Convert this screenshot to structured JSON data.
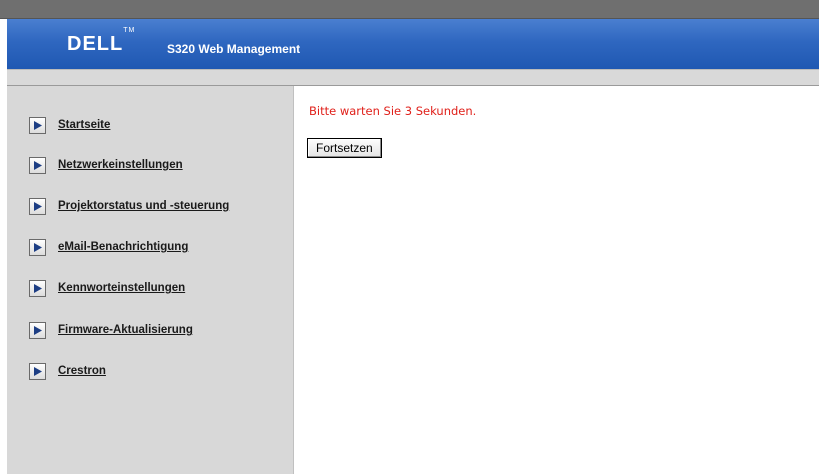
{
  "header": {
    "logo_text": "DELL",
    "logo_tm": "TM",
    "title": "S320 Web Management"
  },
  "sidebar": {
    "items": [
      {
        "label": "Startseite",
        "icon": "arrow-right-icon"
      },
      {
        "label": "Netzwerkeinstellungen",
        "icon": "arrow-right-icon"
      },
      {
        "label": "Projektorstatus und -steuerung",
        "icon": "arrow-right-icon"
      },
      {
        "label": "eMail-Benachrichtigung",
        "icon": "arrow-right-icon"
      },
      {
        "label": "Kennworteinstellungen",
        "icon": "arrow-right-icon"
      },
      {
        "label": "Firmware-Aktualisierung",
        "icon": "arrow-right-icon"
      },
      {
        "label": "Crestron",
        "icon": "arrow-right-icon"
      }
    ]
  },
  "main": {
    "wait_message": "Bitte warten Sie 3 Sekunden.",
    "continue_label": "Fortsetzen"
  },
  "colors": {
    "header_blue": "#2f67c0",
    "wait_text": "#e0201a",
    "sidebar_bg": "#d8d8d8"
  }
}
